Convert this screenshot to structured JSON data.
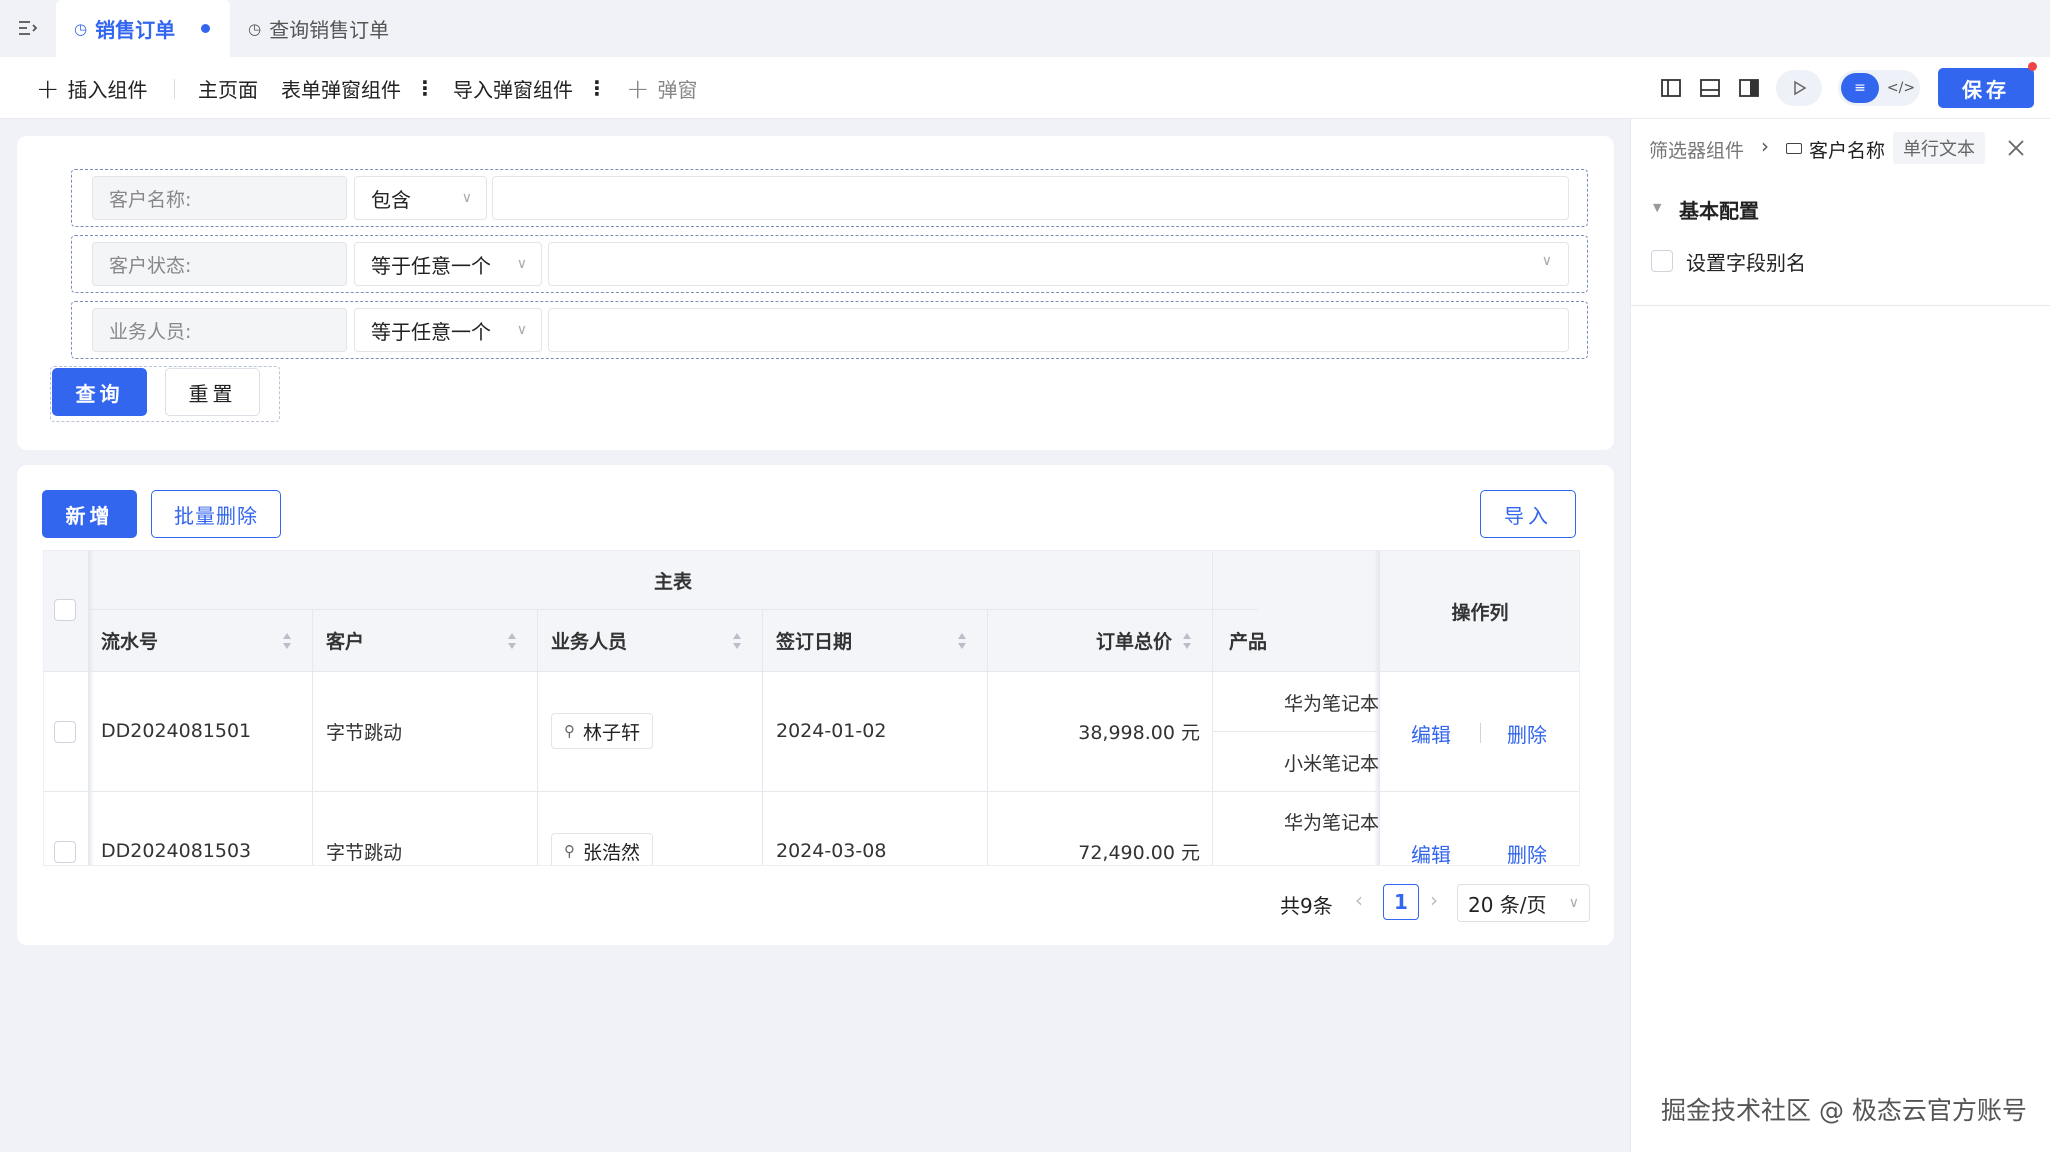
{
  "tabs": [
    {
      "label": "销售订单",
      "active": true
    },
    {
      "label": "查询销售订单",
      "active": false
    }
  ],
  "toolbar": {
    "insert_label": "插入组件",
    "main_page": "主页面",
    "form_popup": "表单弹窗组件",
    "import_popup": "导入弹窗组件",
    "popup": "弹窗",
    "save": "保存"
  },
  "filters": [
    {
      "label": "客户名称:",
      "op": "包含",
      "value": ""
    },
    {
      "label": "客户状态:",
      "op": "等于任意一个",
      "value": ""
    },
    {
      "label": "业务人员:",
      "op": "等于任意一个",
      "value": ""
    }
  ],
  "filter_actions": {
    "query": "查询",
    "reset": "重置"
  },
  "table_actions": {
    "add": "新增",
    "batch_delete": "批量删除",
    "import": "导入"
  },
  "table": {
    "group_header": "主表",
    "op_header": "操作列",
    "columns": [
      "流水号",
      "客户",
      "业务人员",
      "签订日期",
      "订单总价",
      "产品"
    ],
    "rows": [
      {
        "id": "DD2024081501",
        "customer": "字节跳动",
        "staff": "林子轩",
        "date": "2024-01-02",
        "total": "38,998.00 元",
        "products": [
          "华为笔记本",
          "小米笔记本"
        ],
        "edit": "编辑",
        "delete": "删除"
      },
      {
        "id": "DD2024081503",
        "customer": "字节跳动",
        "staff": "张浩然",
        "date": "2024-03-08",
        "total": "72,490.00 元",
        "products": [
          "华为笔记本"
        ],
        "edit": "编辑",
        "delete": "删除"
      }
    ]
  },
  "pagination": {
    "total": "共9条",
    "current": "1",
    "page_size": "20 条/页"
  },
  "right_panel": {
    "crumb_parent": "筛选器组件",
    "crumb_current": "客户名称",
    "type_badge": "单行文本",
    "section": "基本配置",
    "option": "设置字段别名"
  },
  "watermark": "掘金技术社区 @ 极态云官方账号",
  "colors": {
    "primary": "#3366ee",
    "background": "#f0f2f7"
  }
}
